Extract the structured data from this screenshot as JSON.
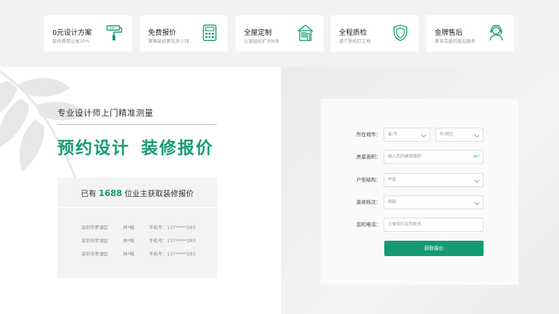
{
  "features": [
    {
      "title": "0元设计方案",
      "subtitle": "装修费用立省30%",
      "icon": "paint-roller-icon"
    },
    {
      "title": "免费报价",
      "subtitle": "算算装修要花多少钱",
      "icon": "calculator-icon"
    },
    {
      "title": "全屋定制",
      "subtitle": "让家轻松扩大N倍",
      "icon": "house-cabinet-icon"
    },
    {
      "title": "全程质检",
      "subtitle": "请个质检盯工地",
      "icon": "shield-icon"
    },
    {
      "title": "金牌售后",
      "subtitle": "尊享完善的售后服务",
      "icon": "support-agent-icon"
    }
  ],
  "left": {
    "subheading": "专业设计师上门精准测量",
    "headline_part1": "预约设计",
    "headline_part2": "装修报价",
    "card_prefix": "已有",
    "card_count": "1688",
    "card_suffix": "位业主获取装修报价",
    "records": [
      {
        "city": "深圳市罗湖区",
        "name": "林*梅",
        "phone": "手机号：137*****283"
      },
      {
        "city": "深圳市罗湖区",
        "name": "林*梅",
        "phone": "手机号：137*****283"
      },
      {
        "city": "深圳市罗湖区",
        "name": "林*梅",
        "phone": "手机号：137*****283"
      }
    ]
  },
  "form": {
    "city_label": "所在城市：",
    "province_value": "省/市",
    "district_value": "市/地区",
    "area_label": "房屋面积：",
    "area_placeholder": "输入您的建筑面积",
    "area_unit": "m²",
    "layout_label": "户型结构：",
    "layout_value": "平层",
    "grade_label": "装修档次：",
    "grade_value": "简装",
    "phone_label": "您的电话：",
    "phone_placeholder": "方便我们与您联系",
    "submit_label": "获取报价"
  },
  "colors": {
    "accent": "#149b74"
  }
}
